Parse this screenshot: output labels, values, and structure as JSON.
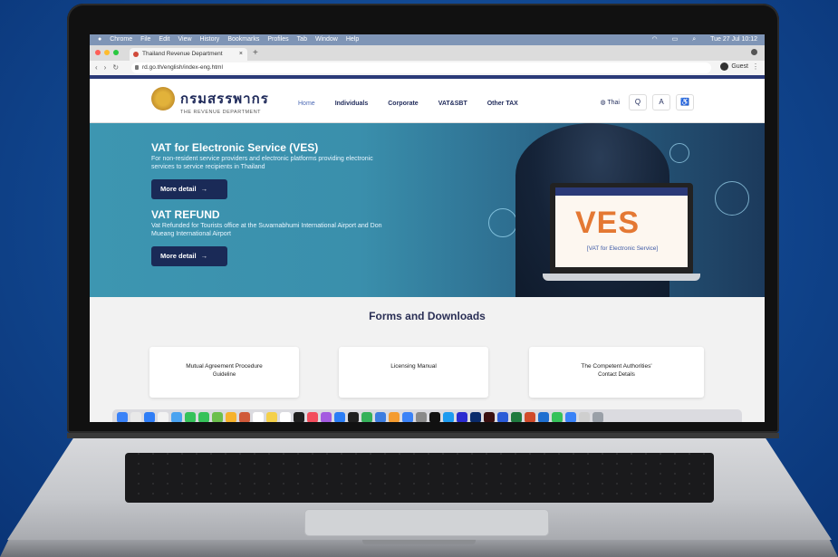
{
  "menubar": {
    "items": [
      "Chrome",
      "File",
      "Edit",
      "View",
      "History",
      "Bookmarks",
      "Profiles",
      "Tab",
      "Window",
      "Help"
    ],
    "clock": "Tue 27 Jul 10:12"
  },
  "browser": {
    "tab_title": "Thailand Revenue Department",
    "tab_close": "×",
    "new_tab": "+",
    "url": "rd.go.th/english/index-eng.html",
    "profile": "Guest",
    "menu": "⋮"
  },
  "site": {
    "logo_th": "กรมสรรพากร",
    "logo_en": "THE REVENUE DEPARTMENT",
    "nav": [
      "Home",
      "Individuals",
      "Corporate",
      "VAT&SBT",
      "Other TAX"
    ],
    "lang": "Thai",
    "tool_search": "Q",
    "tool_text": "A",
    "tool_access": "♿"
  },
  "hero": {
    "ves_title": "VAT for Electronic Service (VES)",
    "ves_desc": "For non-resident service providers and electronic platforms providing electronic services to service recipients in Thailand",
    "ves_btn": "More detail",
    "refund_title": "VAT REFUND",
    "refund_desc": "Vat Refunded for Tourists office at the Suvarnabhumi International Airport and Don Mueang International Airport",
    "refund_btn": "More detail",
    "arrow": "→",
    "laptop_big": "VES",
    "laptop_sub": "[VAT for Electronic Service]"
  },
  "forms": {
    "title": "Forms and Downloads",
    "cards": [
      {
        "line1": "Mutual Agreement Procedure",
        "line2": "Guideline"
      },
      {
        "line1": "Licensing Manual",
        "line2": ""
      },
      {
        "line1": "The Competent Authorities'",
        "line2": "Contact Details"
      }
    ]
  },
  "colors": {
    "brand_navy": "#1f2a5a",
    "hero_teal": "#3d96b1",
    "button_navy": "#1a2a57",
    "ves_orange": "#e47833"
  }
}
